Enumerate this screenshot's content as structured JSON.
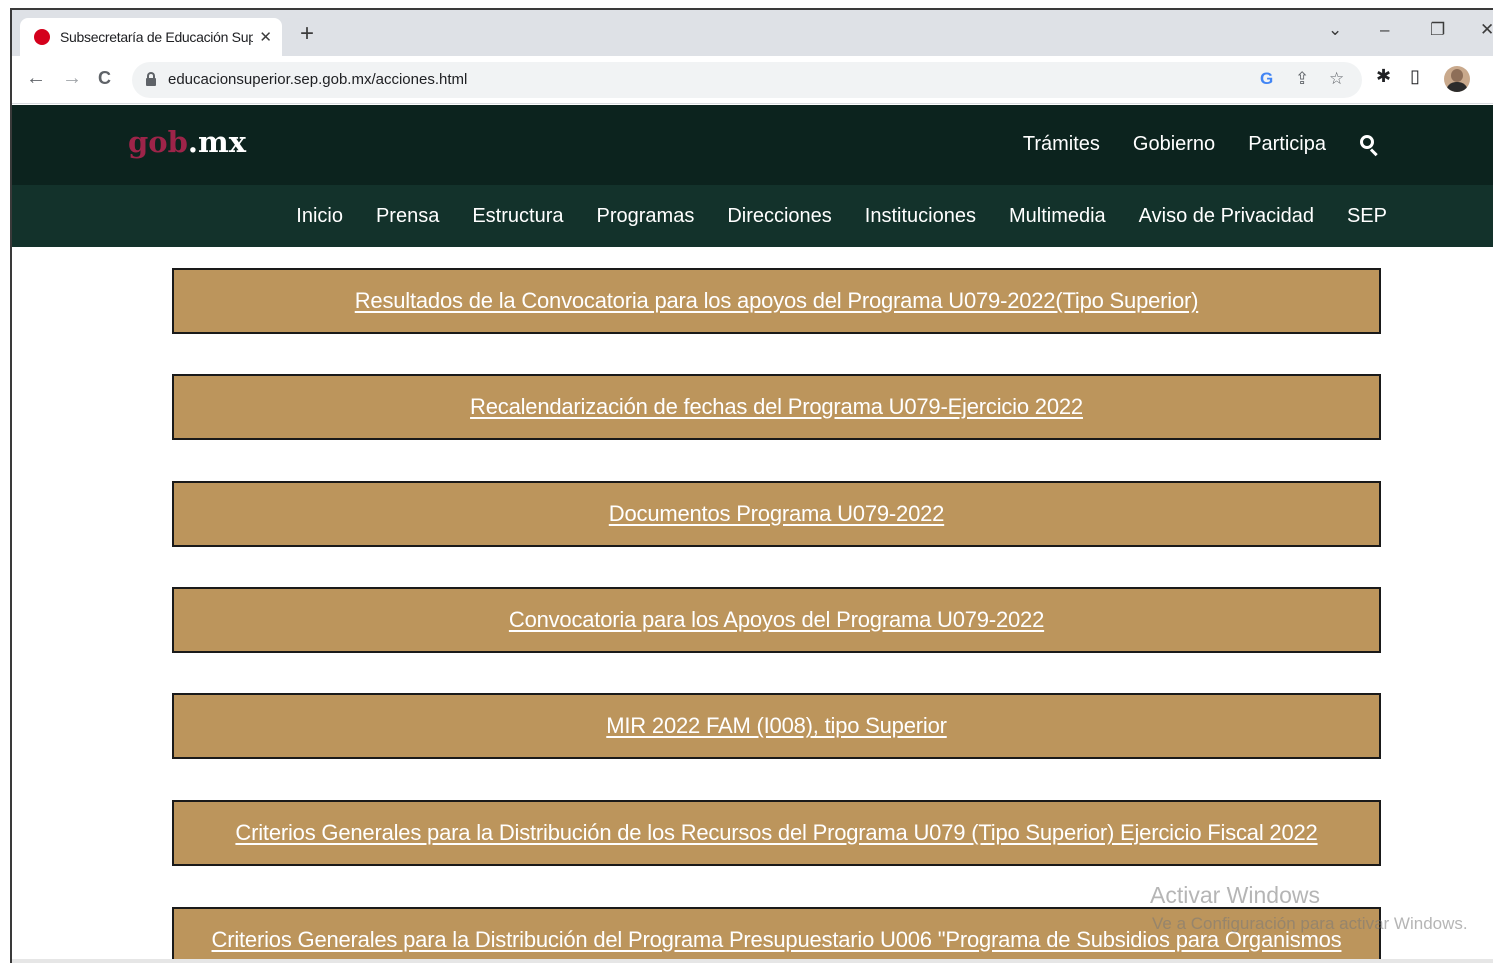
{
  "browser": {
    "tab_title": "Subsecretaría de Educación Supe",
    "tab_close": "✕",
    "new_tab": "+",
    "window_controls": {
      "dropdown": "⌄",
      "minimize": "–",
      "restore": "❐",
      "close": "✕"
    },
    "nav": {
      "back": "←",
      "forward": "→",
      "reload": "C"
    },
    "url": "educacionsuperior.sep.gob.mx/acciones.html",
    "omnibox_icons": {
      "google": "G",
      "share": "⇪",
      "bookmark": "☆"
    },
    "toolbar_icons": {
      "extensions": "✱",
      "side_panel": "▯",
      "menu": "⋮"
    }
  },
  "site_header": {
    "logo_gob": "gob",
    "logo_mx": ".mx",
    "top_links": [
      "Trámites",
      "Gobierno",
      "Participa"
    ]
  },
  "site_nav": [
    "Inicio",
    "Prensa",
    "Estructura",
    "Programas",
    "Direcciones",
    "Instituciones",
    "Multimedia",
    "Aviso de Privacidad",
    "SEP"
  ],
  "links": [
    "Resultados de la Convocatoria para los apoyos del Programa U079-2022(Tipo Superior)",
    "Recalendarización de fechas del Programa U079-Ejercicio 2022",
    "Documentos Programa U079-2022",
    "Convocatoria para los Apoyos del Programa U079-2022",
    "MIR 2022 FAM (I008), tipo Superior",
    "Criterios Generales para la Distribución de los Recursos del Programa U079 (Tipo Superior) Ejercicio Fiscal 2022",
    "Criterios Generales para la Distribución del Programa Presupuestario U006 \"Programa de Subsidios para Organismos"
  ],
  "watermark": {
    "line1": "Activar Windows",
    "line2": "Ve a Configuración para activar Windows."
  }
}
